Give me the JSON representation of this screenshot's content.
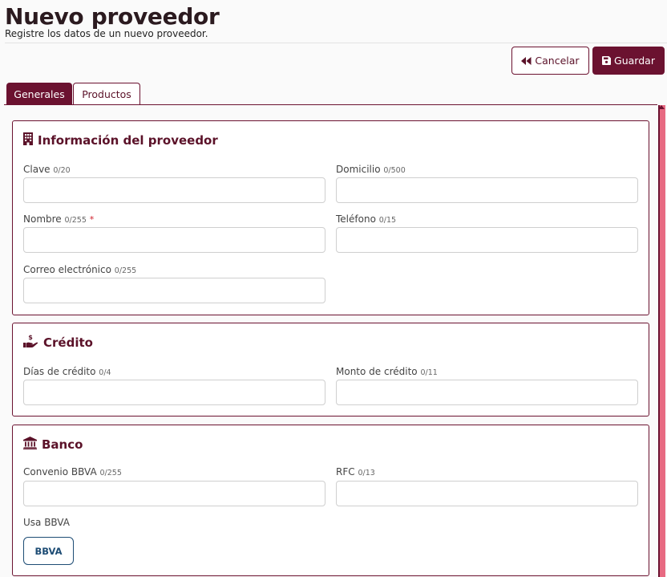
{
  "header": {
    "title": "Nuevo proveedor",
    "subtitle": "Registre los datos de un nuevo proveedor."
  },
  "actions": {
    "cancel_label": "Cancelar",
    "save_label": "Guardar"
  },
  "tabs": [
    {
      "label": "Generales",
      "active": true
    },
    {
      "label": "Productos",
      "active": false
    }
  ],
  "sections": {
    "info": {
      "title": "Información del proveedor",
      "icon": "building-icon",
      "fields": {
        "clave": {
          "label": "Clave",
          "count": "0/20",
          "value": ""
        },
        "domicilio": {
          "label": "Domicilio",
          "count": "0/500",
          "value": ""
        },
        "nombre": {
          "label": "Nombre",
          "count": "0/255",
          "required": "*",
          "value": ""
        },
        "telefono": {
          "label": "Teléfono",
          "count": "0/15",
          "value": ""
        },
        "correo": {
          "label": "Correo electrónico",
          "count": "0/255",
          "value": ""
        }
      }
    },
    "credito": {
      "title": "Crédito",
      "icon": "hand-holding-dollar-icon",
      "fields": {
        "dias": {
          "label": "Días de crédito",
          "count": "0/4",
          "value": ""
        },
        "monto": {
          "label": "Monto de crédito",
          "count": "0/11",
          "value": ""
        }
      }
    },
    "banco": {
      "title": "Banco",
      "icon": "bank-icon",
      "fields": {
        "convenio": {
          "label": "Convenio BBVA",
          "count": "0/255",
          "value": ""
        },
        "rfc": {
          "label": "RFC",
          "count": "0/13",
          "value": ""
        }
      },
      "usa_bbva_label": "Usa BBVA",
      "bbva_button_label": "BBVA"
    }
  },
  "colors": {
    "primary": "#6b1230",
    "scrollbar": "#e76a82",
    "bbva": "#1e4d75",
    "required": "#d0202c"
  }
}
